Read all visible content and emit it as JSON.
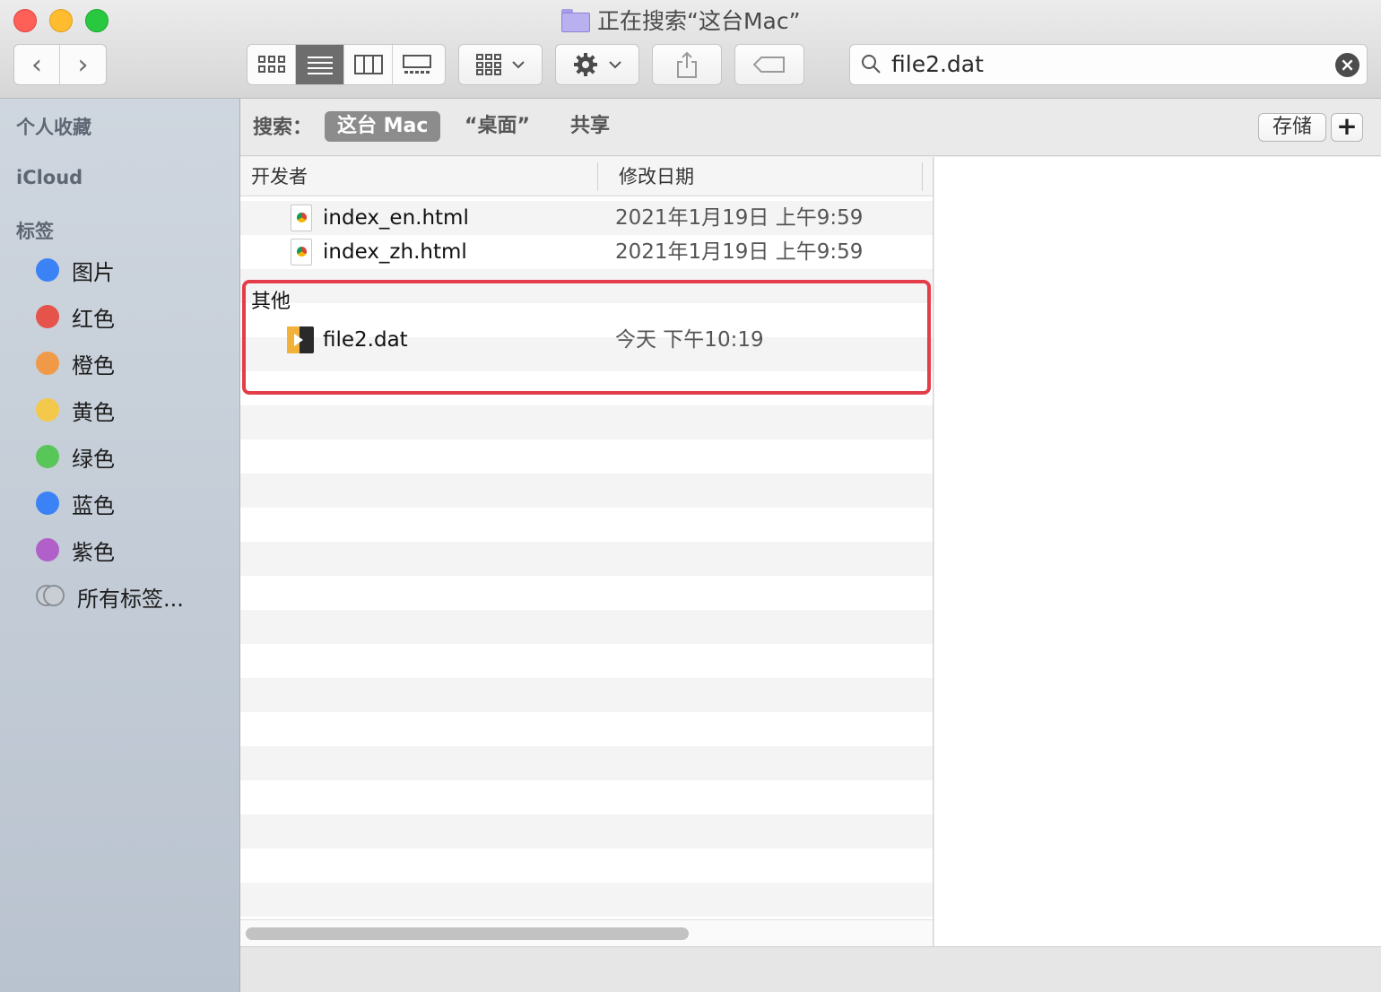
{
  "window": {
    "title": "正在搜索“这台Mac”",
    "nav_back": "‹",
    "nav_forward": "›"
  },
  "toolbar": {
    "view_modes": [
      "icon-view",
      "list-view",
      "column-view",
      "gallery-view"
    ],
    "active_view": "list-view",
    "group_button": "group-by",
    "action_button": "action-gear",
    "share_button": "share",
    "tag_button": "tag"
  },
  "search": {
    "value": "file2.dat",
    "clear": "×"
  },
  "sidebar": {
    "favorites": "个人收藏",
    "icloud": "iCloud",
    "tags_heading": "标签",
    "tags": [
      {
        "label": "图片",
        "color": "#3b82f6"
      },
      {
        "label": "红色",
        "color": "#e5534b"
      },
      {
        "label": "橙色",
        "color": "#f09a48"
      },
      {
        "label": "黄色",
        "color": "#f4c84a"
      },
      {
        "label": "绿色",
        "color": "#58c658"
      },
      {
        "label": "蓝色",
        "color": "#3b82f6"
      },
      {
        "label": "紫色",
        "color": "#b160c9"
      }
    ],
    "all_tags": "所有标签..."
  },
  "scope": {
    "label": "搜索：",
    "options": [
      "这台 Mac",
      "“桌面”",
      "共享"
    ],
    "active": 0,
    "save": "存储",
    "add": "+"
  },
  "list": {
    "columns": [
      "开发者",
      "修改日期"
    ],
    "files": [
      {
        "name": "index_en.html",
        "date": "2021年1月19日 上午9:59",
        "icon": "html-file-icon"
      },
      {
        "name": "index_zh.html",
        "date": "2021年1月19日 上午9:59",
        "icon": "html-file-icon"
      }
    ],
    "group_label": "其他",
    "other_files": [
      {
        "name": "file2.dat",
        "date": "今天 下午10:19",
        "icon": "dat-file-icon"
      }
    ],
    "highlight_color": "#e43d4a"
  }
}
